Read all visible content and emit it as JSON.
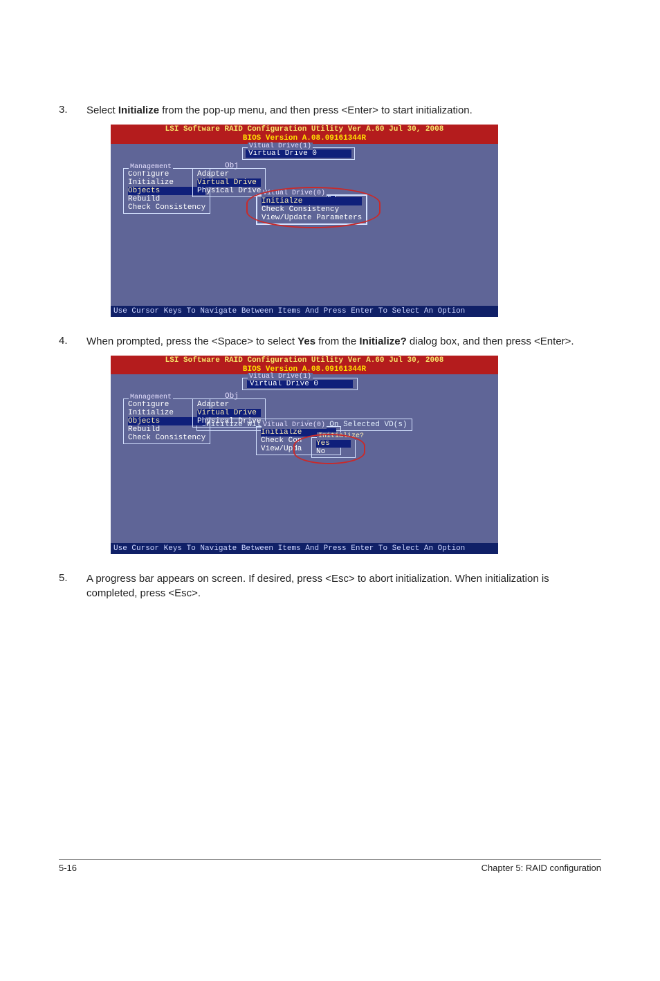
{
  "step3": {
    "num": "3.",
    "text_a": "Select ",
    "bold_a": "Initialize",
    "text_b": " from the pop-up menu, and then press <Enter> to start initialization."
  },
  "step4": {
    "num": "4.",
    "text_a": "When prompted, press the <Space> to select ",
    "bold_a": "Yes",
    "text_b": " from the ",
    "bold_b": "Initialize?",
    "text_c": " dialog box, and then press <Enter>."
  },
  "step5": {
    "num": "5.",
    "text_a": "A progress bar appears on screen. If desired, press <Esc> to abort initialization. When initialization is completed, press <Esc>."
  },
  "bios": {
    "title1": "LSI Software RAID Configuration Utility Ver A.60 Jul 30, 2008",
    "title2": "BIOS Version   A.08.09161344R",
    "vd1_label": "Vitual Drive(1)",
    "vd0_item": "Virtual Drive 0",
    "obj_label": "Obj",
    "mgmt_label": "Management",
    "mgmt_items": [
      "Configure",
      "Initialize",
      "Objects",
      "Rebuild",
      "Check Consistency"
    ],
    "obj_items": [
      "Adapter",
      "Virtual Drive",
      "Physical Drive"
    ],
    "vd0_label": "Vitual Drive(0)",
    "actions": [
      "Initialze",
      "Check Consistency",
      "View/Update Parameters"
    ],
    "actions_b": [
      "Initialze",
      "Check Con",
      "View/Upda"
    ],
    "init_q_label": "Initialize?",
    "init_opts": [
      "Yes",
      "No"
    ],
    "init_vd": "Initilize VD",
    "init_warn": "Initilize Will Destroy Data On Selected VD(s)",
    "help": "Use Cursor Keys To Navigate Between Items And Press Enter To Select An Option"
  },
  "footer": {
    "left": "5-16",
    "right": "Chapter 5: RAID configuration"
  }
}
